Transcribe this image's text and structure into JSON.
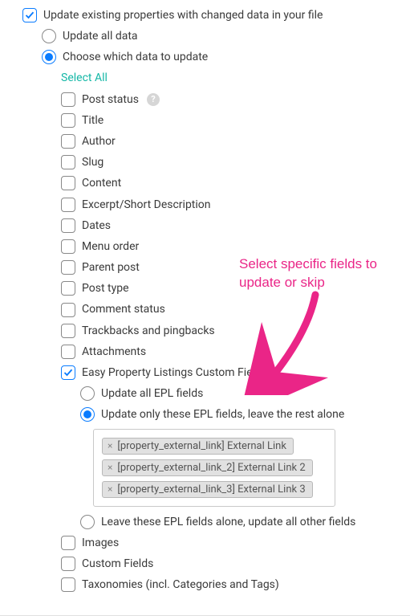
{
  "top": {
    "label": "Update existing properties with changed data in your file",
    "checked": true
  },
  "update_mode": {
    "all_label": "Update all data",
    "choose_label": "Choose which data to update",
    "selected": "choose"
  },
  "select_all_label": "Select All",
  "fields": [
    {
      "key": "post_status",
      "label": "Post status",
      "checked": false,
      "help": true
    },
    {
      "key": "title",
      "label": "Title",
      "checked": false
    },
    {
      "key": "author",
      "label": "Author",
      "checked": false
    },
    {
      "key": "slug",
      "label": "Slug",
      "checked": false
    },
    {
      "key": "content",
      "label": "Content",
      "checked": false
    },
    {
      "key": "excerpt",
      "label": "Excerpt/Short Description",
      "checked": false
    },
    {
      "key": "dates",
      "label": "Dates",
      "checked": false
    },
    {
      "key": "menu_order",
      "label": "Menu order",
      "checked": false
    },
    {
      "key": "parent_post",
      "label": "Parent post",
      "checked": false
    },
    {
      "key": "post_type",
      "label": "Post type",
      "checked": false
    },
    {
      "key": "comment_status",
      "label": "Comment status",
      "checked": false
    },
    {
      "key": "trackbacks",
      "label": "Trackbacks and pingbacks",
      "checked": false
    },
    {
      "key": "attachments",
      "label": "Attachments",
      "checked": false
    },
    {
      "key": "epl",
      "label": "Easy Property Listings Custom Fields",
      "checked": true
    },
    {
      "key": "images",
      "label": "Images",
      "checked": false
    },
    {
      "key": "custom_fields",
      "label": "Custom Fields",
      "checked": false
    },
    {
      "key": "taxonomies",
      "label": "Taxonomies (incl. Categories and Tags)",
      "checked": false
    }
  ],
  "epl_options": {
    "update_all_label": "Update all EPL fields",
    "update_only_label": "Update only these EPL fields, leave the rest alone",
    "leave_alone_label": "Leave these EPL fields alone, update all other fields",
    "selected": "update_only",
    "tags": [
      "[property_external_link] External Link",
      "[property_external_link_2] External Link 2",
      "[property_external_link_3] External Link 3"
    ]
  },
  "annotation": "Select specific fields to update or skip"
}
